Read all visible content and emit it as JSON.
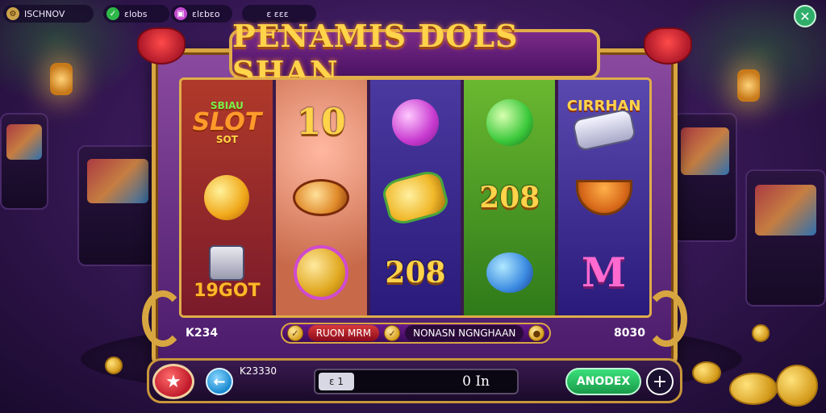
{
  "topbar": {
    "account_label": "ISCHNOV",
    "item_b_label": "ɛlobs",
    "item_c_label": "ɛlɛbɛo",
    "item_d_label": "ɛ ɛɛɛ"
  },
  "title": "PENAMIS DOLS SHAN",
  "reels": [
    {
      "symbols": [
        {
          "type": "logo",
          "lines": [
            "SBIAU",
            "SLOT",
            "SOT"
          ]
        },
        {
          "type": "orb",
          "icon": "gold-fruit-icon"
        },
        {
          "type": "bonus",
          "text": "19GOT",
          "icon": "robot-tank-icon"
        }
      ]
    },
    {
      "symbols": [
        {
          "type": "number",
          "text": "10"
        },
        {
          "type": "food",
          "icon": "sausage-plate-icon"
        },
        {
          "type": "coin",
          "icon": "gold-coin-stack-icon"
        }
      ]
    },
    {
      "symbols": [
        {
          "type": "orb",
          "icon": "pink-gem-icon"
        },
        {
          "type": "food",
          "icon": "bread-slice-icon"
        },
        {
          "type": "number",
          "text": "208"
        }
      ]
    },
    {
      "symbols": [
        {
          "type": "orb",
          "icon": "green-gem-icon"
        },
        {
          "type": "number",
          "text": "208"
        },
        {
          "type": "orb",
          "icon": "blue-bell-icon"
        }
      ]
    },
    {
      "symbols": [
        {
          "type": "label",
          "text": "CIRRHAN",
          "icon": "white-tank-icon"
        },
        {
          "type": "food",
          "icon": "bowl-icon"
        },
        {
          "type": "letter",
          "text": "M"
        }
      ]
    }
  ],
  "info": {
    "left_value": "K234",
    "mid_left": "RUON MRM",
    "mid_right": "NONASN NGNGHAAN",
    "right_value": "8030"
  },
  "controls": {
    "balance": "K23330",
    "bet_chip": "ɛ 1",
    "bet_value": "0 In",
    "spin_label": "ANODEX",
    "plus_label": "+"
  },
  "colors": {
    "title_gold": "#ffd34a",
    "frame_gold": "#d8a640",
    "spin_green": "#2ed06a",
    "home_red": "#d02a3a",
    "back_blue": "#1a8ad0"
  }
}
